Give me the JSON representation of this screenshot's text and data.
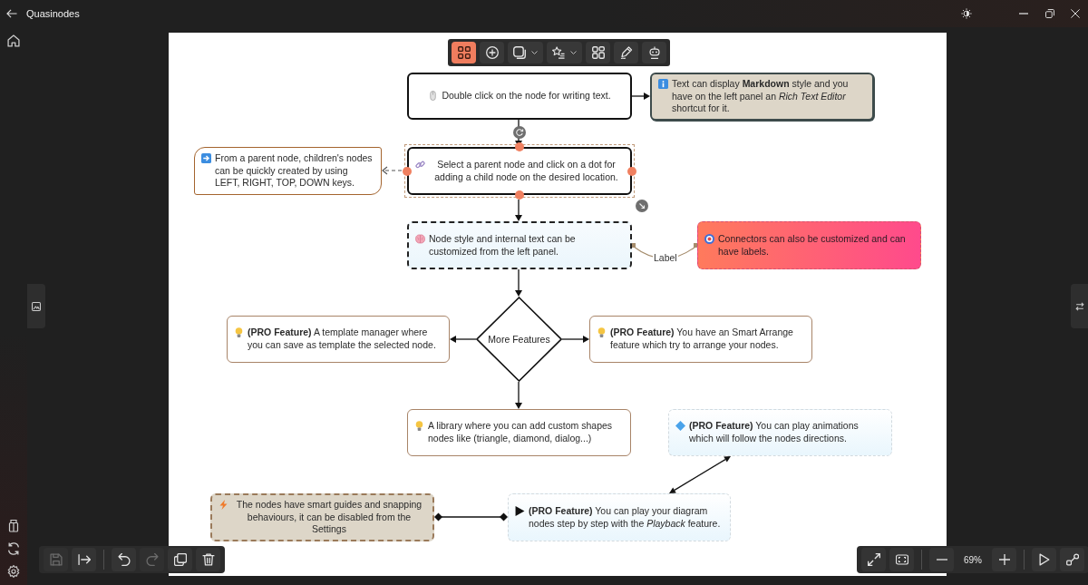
{
  "window": {
    "title": "Quasinodes"
  },
  "toolbar": {
    "tools": [
      {
        "selected": true,
        "dropdown": false
      },
      {
        "selected": false,
        "dropdown": false
      },
      {
        "selected": false,
        "dropdown": true
      },
      {
        "selected": false,
        "dropdown": true
      },
      {
        "selected": false,
        "dropdown": false
      },
      {
        "selected": false,
        "dropdown": false
      },
      {
        "selected": false,
        "dropdown": false
      }
    ]
  },
  "diagram": {
    "nodes": [
      {
        "kind": "plain",
        "text": "Double click on the node for writing text.",
        "selected": false
      },
      {
        "kind": "note",
        "text": "Text can display **Markdown** style and you have on the left panel an *Rich Text Editor* shortcut for it.",
        "selected": false
      },
      {
        "kind": "callout",
        "text": "From a parent node, children's nodes can be quickly created by using LEFT, RIGHT, TOP, DOWN keys.",
        "selected": false
      },
      {
        "kind": "plain",
        "text": "Select a parent node and click on a dot for adding a child node on the desired location.",
        "selected": true
      },
      {
        "kind": "dashed",
        "text": "Node style and internal text can be customized from the left panel.",
        "selected": false
      },
      {
        "kind": "pink",
        "text": "Connectors can also be customized and can have labels.",
        "selected": false
      },
      {
        "kind": "brown",
        "text": "**(PRO Feature)** A template manager where you can save as template the selected node.",
        "selected": false
      },
      {
        "kind": "diamond",
        "text": "More Features",
        "selected": false
      },
      {
        "kind": "brown",
        "text": "**(PRO Feature)** You have an Smart Arrange feature which try to arrange your nodes.",
        "selected": false
      },
      {
        "kind": "brown",
        "text": "A library where you can add custom shapes nodes like (triangle, diamond, dialog...)",
        "selected": false
      },
      {
        "kind": "sky",
        "text": "**(PRO Feature)** You can play animations which will follow the nodes directions.",
        "selected": false
      },
      {
        "kind": "sand",
        "text": "The nodes have smart guides and snapping behaviours, it can be disabled from the Settings",
        "selected": false
      },
      {
        "kind": "sky",
        "text": "**(PRO Feature)** You can play your diagram nodes step by step with the *Playback* feature.",
        "selected": false
      }
    ],
    "connector_label": "Label"
  },
  "edit_bar": {
    "buttons": [
      {
        "disabled": true
      },
      {
        "disabled": false
      },
      {
        "disabled": false
      },
      {
        "disabled": true
      },
      {
        "disabled": false
      },
      {
        "disabled": false
      }
    ]
  },
  "view_bar": {
    "zoom": "69%"
  }
}
